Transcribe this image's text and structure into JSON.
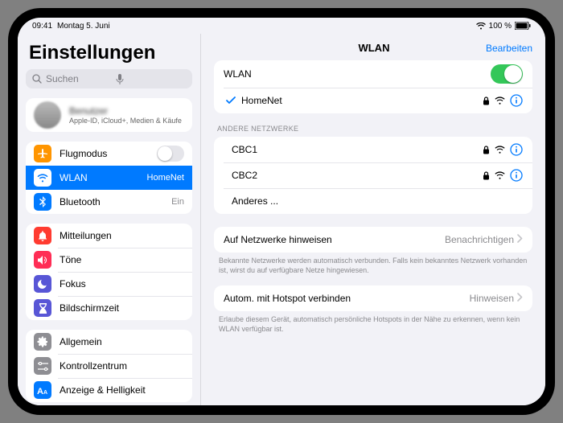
{
  "statusbar": {
    "time": "09:41",
    "date": "Montag 5. Juni",
    "battery": "100 %"
  },
  "sidebar": {
    "title": "Einstellungen",
    "search_placeholder": "Suchen",
    "account": {
      "name": "Benutzer",
      "sub": "Apple-ID, iCloud+, Medien & Käufe"
    },
    "g1": {
      "airplane": "Flugmodus",
      "wlan": "WLAN",
      "wlan_detail": "HomeNet",
      "bt": "Bluetooth",
      "bt_detail": "Ein"
    },
    "g2": {
      "notif": "Mitteilungen",
      "sounds": "Töne",
      "focus": "Fokus",
      "screentime": "Bildschirmzeit"
    },
    "g3": {
      "general": "Allgemein",
      "control": "Kontrollzentrum",
      "display": "Anzeige & Helligkeit"
    }
  },
  "content": {
    "title": "WLAN",
    "edit": "Bearbeiten",
    "wlan_label": "WLAN",
    "connected": "HomeNet",
    "other_hdr": "ANDERE NETZWERKE",
    "nets": {
      "0": "CBC1",
      "1": "CBC2",
      "other": "Anderes ..."
    },
    "ask": {
      "label": "Auf Netzwerke hinweisen",
      "value": "Benachrichtigen",
      "foot": "Bekannte Netzwerke werden automatisch verbunden. Falls kein bekanntes Netzwerk vorhanden ist, wirst du auf verfügbare Netze hingewiesen."
    },
    "hotspot": {
      "label": "Autom. mit Hotspot verbinden",
      "value": "Hinweisen",
      "foot": "Erlaube diesem Gerät, automatisch persönliche Hotspots in der Nähe zu erkennen, wenn kein WLAN verfügbar ist."
    }
  },
  "colors": {
    "airplane": "#ff9500",
    "wlan": "#007aff",
    "bt": "#007aff",
    "notif": "#ff3b30",
    "sounds": "#ff2d55",
    "focus": "#5856d6",
    "screentime": "#5856d6",
    "general": "#8e8e93",
    "control": "#8e8e93",
    "display": "#007aff"
  }
}
